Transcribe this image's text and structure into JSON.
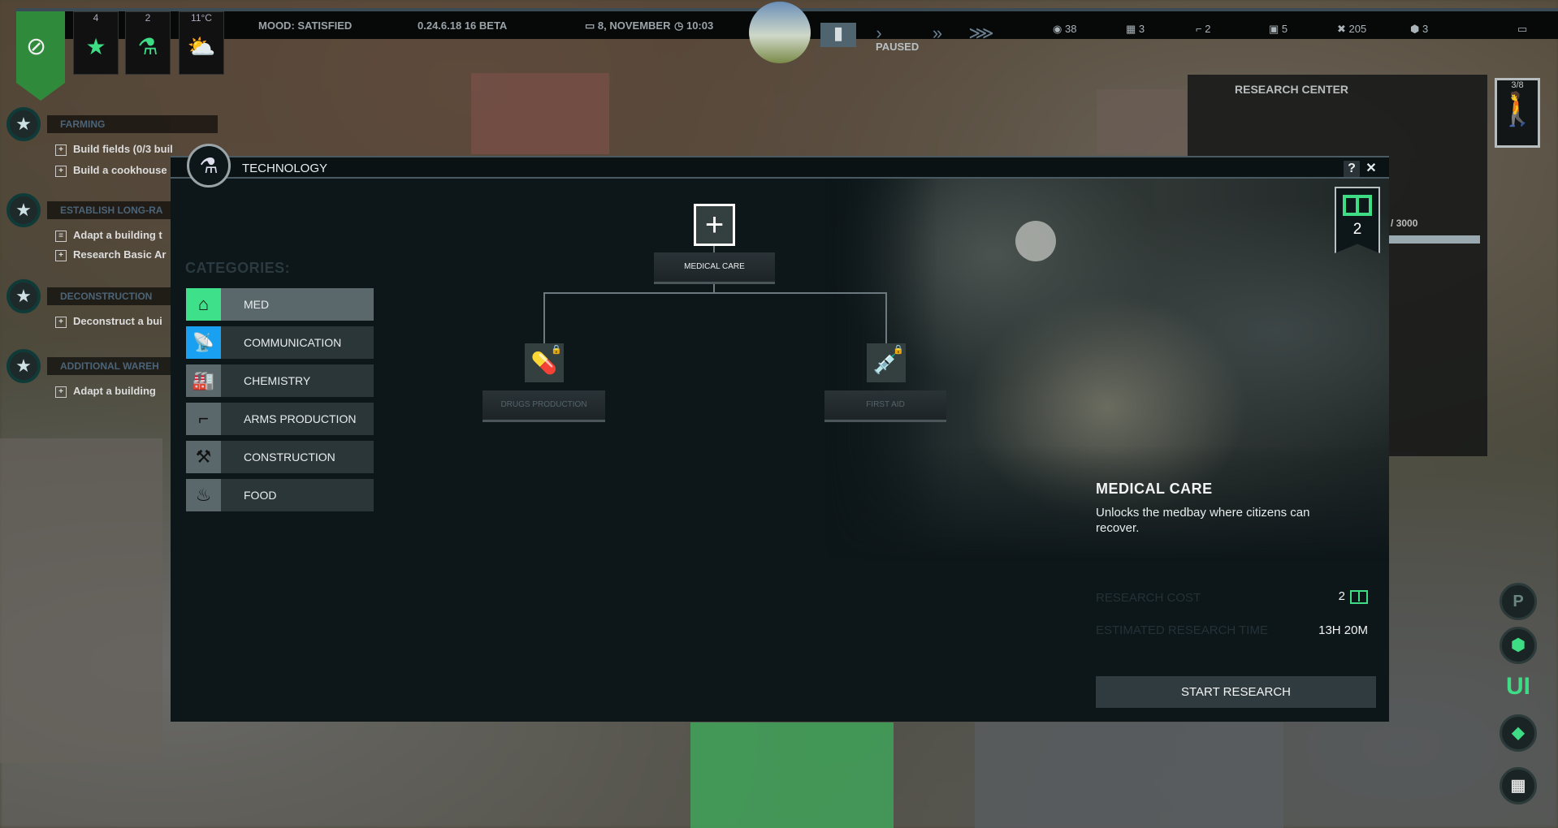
{
  "hud": {
    "tiles": [
      {
        "value": "4",
        "icon": "star-icon"
      },
      {
        "value": "2",
        "icon": "flask-icon"
      },
      {
        "value": "11°C",
        "icon": "weather-icon"
      }
    ],
    "mood": "MOOD: SATISFIED",
    "version": "0.24.6.18 16 BETA",
    "date": "8, NOVEMBER",
    "time": "10:03",
    "paused": "PAUSED",
    "resources": [
      {
        "icon": "citizens-icon",
        "value": "38"
      },
      {
        "icon": "housing-icon",
        "value": "3"
      },
      {
        "icon": "weapon-icon",
        "value": "2"
      },
      {
        "icon": "med-icon",
        "value": "5"
      },
      {
        "icon": "tools-icon",
        "value": "205"
      },
      {
        "icon": "storage-icon",
        "value": "3"
      }
    ]
  },
  "quests": [
    {
      "title": "FARMING",
      "items": [
        "Build fields (0/3 buil",
        "Build a cookhouse"
      ]
    },
    {
      "title": "ESTABLISH LONG-RA",
      "items": [
        "Adapt a building t",
        "Research Basic Ar"
      ]
    },
    {
      "title": "DECONSTRUCTION",
      "items": [
        "Deconstruct a bui"
      ]
    },
    {
      "title": "ADDITIONAL WAREH",
      "items": [
        "Adapt a building"
      ]
    }
  ],
  "research_center": {
    "title": "RESEARCH CENTER",
    "progress": "3000 / 3000",
    "workers": "3/8"
  },
  "side_buttons": [
    "P",
    "",
    "UI",
    "",
    ""
  ],
  "dialog": {
    "title": "TECHNOLOGY",
    "help": "?",
    "close": "✕",
    "research_points": "2",
    "categories_label": "CATEGORIES:",
    "categories": [
      {
        "label": "MED",
        "color": "#3fe08a",
        "icon": "med-house-icon",
        "selected": true
      },
      {
        "label": "COMMUNICATION",
        "color": "#1aa0f0",
        "icon": "antenna-icon"
      },
      {
        "label": "CHEMISTRY",
        "color": "#5a686c",
        "icon": "factory-icon"
      },
      {
        "label": "ARMS PRODUCTION",
        "color": "#5a686c",
        "icon": "rifle-icon"
      },
      {
        "label": "CONSTRUCTION",
        "color": "#5a686c",
        "icon": "tools-icon"
      },
      {
        "label": "FOOD",
        "color": "#5a686c",
        "icon": "bowl-icon"
      }
    ],
    "tree": {
      "root": {
        "label": "MEDICAL CARE",
        "icon": "cross-icon"
      },
      "children": [
        {
          "label": "DRUGS PRODUCTION",
          "icon": "pill-icon",
          "locked": true
        },
        {
          "label": "FIRST AID",
          "icon": "syringe-icon",
          "locked": true
        }
      ]
    },
    "info": {
      "title": "MEDICAL CARE",
      "description": "Unlocks the medbay where citizens can recover.",
      "cost_label": "RESEARCH COST",
      "cost_value": "2",
      "time_label": "ESTIMATED RESEARCH TIME",
      "time_value": "13H 20M",
      "start_button": "START RESEARCH"
    }
  }
}
